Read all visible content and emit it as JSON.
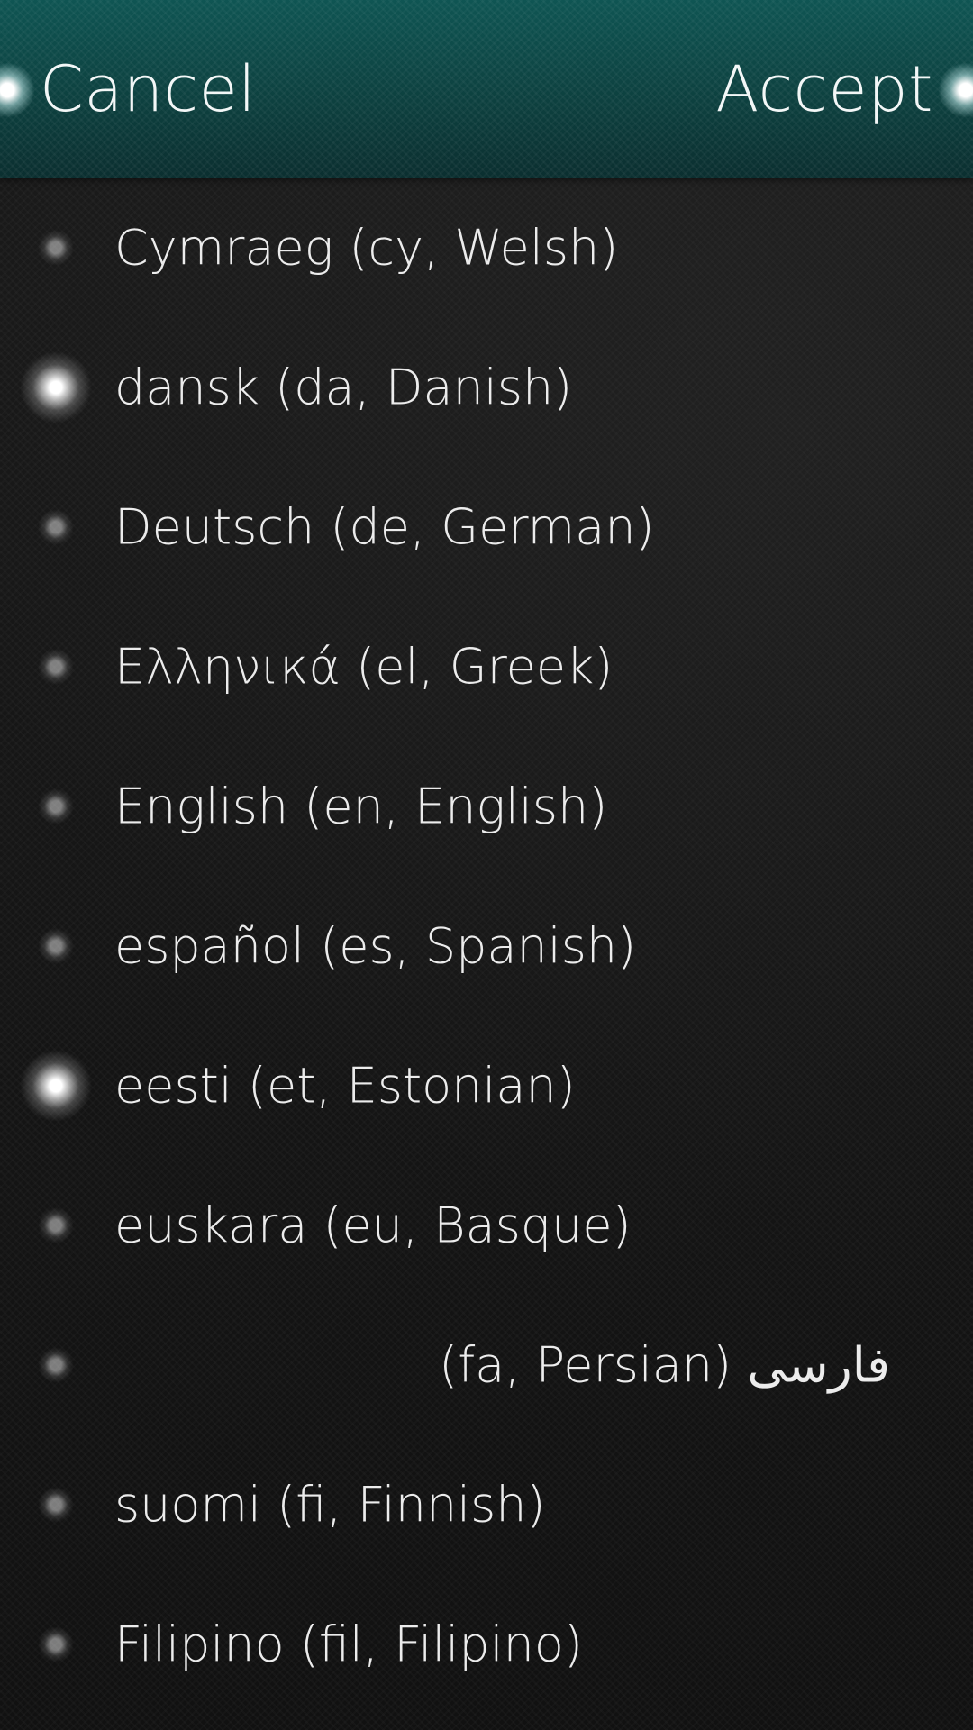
{
  "header": {
    "cancel_label": "Cancel",
    "accept_label": "Accept",
    "color": "#0f5553"
  },
  "languages": [
    {
      "label": "Cymraeg (cy, Welsh)",
      "selected": false
    },
    {
      "label": "dansk (da, Danish)",
      "selected": true
    },
    {
      "label": "Deutsch (de, German)",
      "selected": false
    },
    {
      "label": "Ελληνικά (el, Greek)",
      "selected": false
    },
    {
      "label": "English (en, English)",
      "selected": false
    },
    {
      "label": "español (es, Spanish)",
      "selected": false
    },
    {
      "label": "eesti (et, Estonian)",
      "selected": true
    },
    {
      "label": "euskara (eu, Basque)",
      "selected": false
    },
    {
      "label": "فارسی (fa, Persian)",
      "selected": false,
      "rtl": true
    },
    {
      "label": "suomi (fi, Finnish)",
      "selected": false
    },
    {
      "label": "Filipino (fil, Filipino)",
      "selected": false
    }
  ]
}
